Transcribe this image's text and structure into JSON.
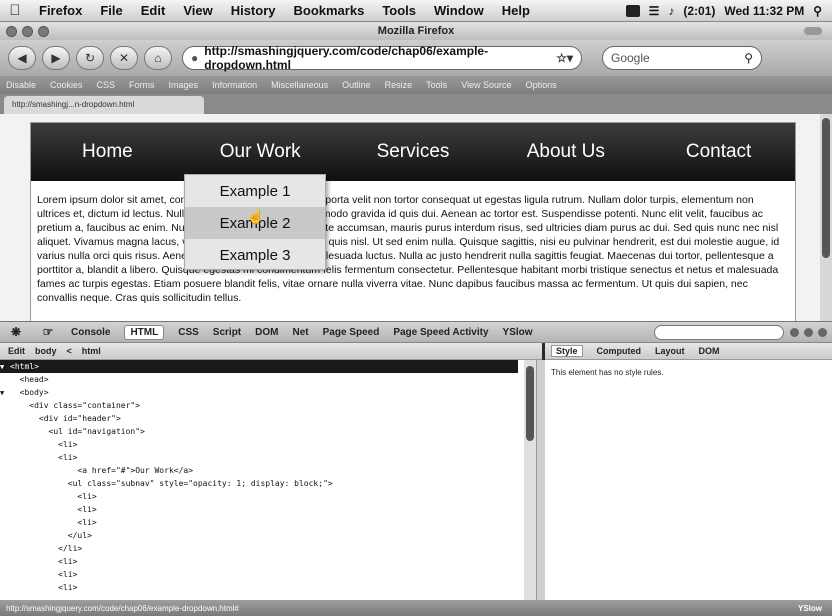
{
  "menubar": {
    "app": "Firefox",
    "items": [
      "File",
      "Edit",
      "View",
      "History",
      "Bookmarks",
      "Tools",
      "Window",
      "Help"
    ],
    "clock": "Wed 11:32 PM",
    "battery": "(2:01)"
  },
  "window": {
    "title": "Mozilla Firefox"
  },
  "navbar": {
    "url": "http://smashingjquery.com/code/chap06/example-dropdown.html",
    "search_placeholder": "Google"
  },
  "addonbar": {
    "items": [
      "Disable",
      "Cookies",
      "CSS",
      "Forms",
      "Images",
      "Information",
      "Miscellaneous",
      "Outline",
      "Resize",
      "Tools",
      "View Source",
      "Options"
    ]
  },
  "tab": {
    "label": "http://smashingj...n-dropdown.html"
  },
  "page": {
    "nav": [
      "Home",
      "Our Work",
      "Services",
      "About Us",
      "Contact"
    ],
    "subnav": [
      "Example 1",
      "Example 2",
      "Example 3"
    ],
    "body_text": "Lorem ipsum dolor sit amet, consectetur adipiscing elit. Etiam porta velit non tortor consequat ut egestas ligula rutrum. Nullam dolor turpis, elementum non ultrices et, dictum id lectus. Nullam lorem in tellus ut erat commodo gravida id quis dui. Aenean ac tortor est. Suspendisse potenti. Nunc elit velit, faucibus ac pretium a, faucibus ac enim. Nulla sollicitudin, tellus at vulputate accumsan, mauris purus interdum risus, sed ultricies diam purus ac dui. Sed quis nunc nec nisl aliquet. Vivamus magna lacus, vehicula in porttitor non, iaculis quis nisl. Ut sed enim nulla. Quisque sagittis, nisi eu pulvinar hendrerit, est dui molestie augue, id varius nulla orci quis risus. Aenean convallis orci non dolor malesuada luctus. Nulla ac justo hendrerit nulla sagittis feugiat. Maecenas dui tortor, pellentesque a porttitor a, blandit a libero. Quisque egestas mi condimentum felis fermentum consectetur. Pellentesque habitant morbi tristique senectus et netus et malesuada fames ac turpis egestas. Etiam posuere blandit felis, vitae ornare nulla viverra vitae. Nunc dapibus faucibus massa ac fermentum. Ut quis dui sapien, nec convallis neque. Cras quis sollicitudin tellus."
  },
  "firebug": {
    "tabs": [
      "Console",
      "HTML",
      "CSS",
      "Script",
      "DOM",
      "Net",
      "Page Speed",
      "Page Speed Activity",
      "YSlow"
    ],
    "active_tab": "HTML",
    "crumbs": [
      "Edit",
      "body",
      "html"
    ],
    "side_tabs": [
      "Style",
      "Computed",
      "Layout",
      "DOM"
    ],
    "side_message": "This element has no style rules.",
    "tree": [
      "<html>",
      "  <head>",
      "  <body>",
      "    <div class=\"container\">",
      "      <div id=\"header\">",
      "        <ul id=\"navigation\">",
      "          <li>",
      "          <li>",
      "              <a href=\"#\">Our Work</a>",
      "            <ul class=\"subnav\" style=\"opacity: 1; display: block;\">",
      "              <li>",
      "              <li>",
      "              <li>",
      "            </ul>",
      "          </li>",
      "          <li>",
      "          <li>",
      "          <li>"
    ]
  },
  "status": {
    "url": "http://smashingjquery.com/code/chap06/example-dropdown.html#",
    "yslow": "YSlow"
  },
  "colors": {
    "header_bg": "#1c1c1c",
    "subnav_bg": "#e6e6e6",
    "subnav_hover": "#c8c8c8",
    "selected_row": "#1a1a1a"
  }
}
